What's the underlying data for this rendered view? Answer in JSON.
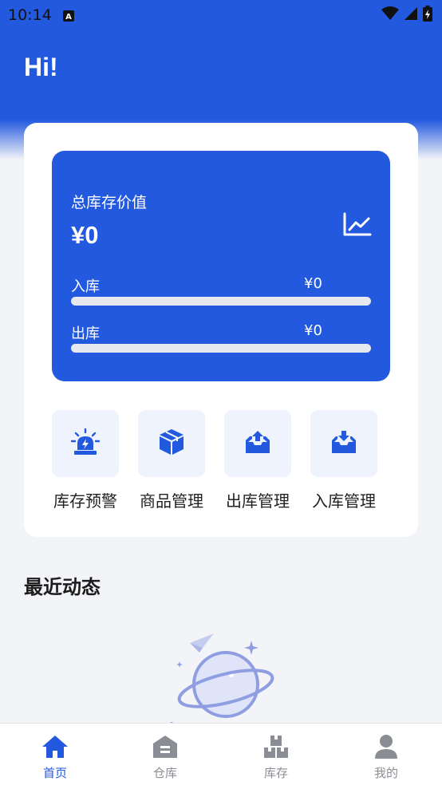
{
  "status_bar": {
    "time": "10:14",
    "icons": [
      "a-notification-icon",
      "wifi-icon",
      "signal-icon",
      "battery-icon"
    ]
  },
  "header": {
    "greeting": "Hi!"
  },
  "inventory": {
    "title": "总库存价值",
    "total_value": "¥0",
    "inbound": {
      "label": "入库",
      "amount": "¥0",
      "progress": 0
    },
    "outbound": {
      "label": "出库",
      "amount": "¥0",
      "progress": 0
    },
    "chart_icon": "line-chart-icon"
  },
  "actions": [
    {
      "label": "库存预警",
      "icon": "alarm-icon"
    },
    {
      "label": "商品管理",
      "icon": "box-icon"
    },
    {
      "label": "出库管理",
      "icon": "outbox-icon"
    },
    {
      "label": "入库管理",
      "icon": "inbox-icon"
    }
  ],
  "recent": {
    "title": "最近动态"
  },
  "nav": {
    "items": [
      {
        "label": "首页",
        "icon": "home-icon",
        "active": true
      },
      {
        "label": "仓库",
        "icon": "warehouse-icon",
        "active": false
      },
      {
        "label": "库存",
        "icon": "inventory-icon",
        "active": false
      },
      {
        "label": "我的",
        "icon": "user-icon",
        "active": false
      }
    ]
  },
  "colors": {
    "brand": "#2259de",
    "tile_bg": "#eef3fd",
    "nav_inactive": "#8a8d93"
  }
}
